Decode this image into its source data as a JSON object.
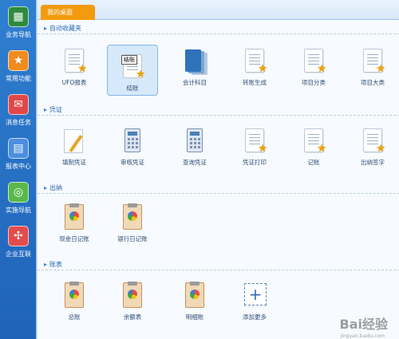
{
  "sidebar": {
    "items": [
      {
        "label": "业务导航",
        "icon": "grid-icon",
        "color": "#2e8b3d"
      },
      {
        "label": "常用功能",
        "icon": "star-icon",
        "color": "#f08b1f"
      },
      {
        "label": "消息任务",
        "icon": "mail-icon",
        "color": "#e04848"
      },
      {
        "label": "报表中心",
        "icon": "report-icon",
        "color": "#4b8ee0"
      },
      {
        "label": "实施导航",
        "icon": "compass-icon",
        "color": "#58b94a"
      },
      {
        "label": "企业互联",
        "icon": "hub-icon",
        "color": "#e44c4c"
      }
    ]
  },
  "tab": {
    "label": "我的桌面"
  },
  "sections": [
    {
      "title": "自动收藏夹",
      "items": [
        "UFO报表",
        "结账",
        "会计科目",
        "转账生成",
        "项目分类",
        "项目大类"
      ],
      "tooltip": "结账"
    },
    {
      "title": "凭证",
      "items": [
        "填制凭证",
        "审核凭证",
        "查询凭证",
        "凭证打印",
        "记账",
        "出纳签字"
      ]
    },
    {
      "title": "出纳",
      "items": [
        "现金日记账",
        "银行日记账"
      ]
    },
    {
      "title": "账表",
      "items": [
        "总账",
        "余额表",
        "明细账",
        "添加更多"
      ]
    }
  ],
  "watermark": {
    "text": "Bai经验",
    "sub": "jingyan.baidu.com"
  }
}
